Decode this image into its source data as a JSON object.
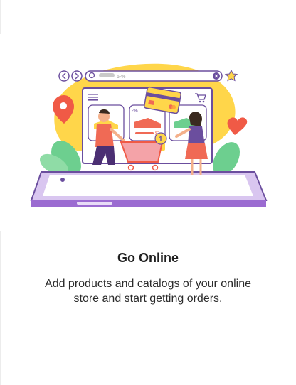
{
  "card": {
    "title": "Go Online",
    "description": "Add products and catalogs of your online store and start getting orders."
  },
  "illustration": {
    "search_text": "5-%",
    "discount_label": "-%",
    "price_label": "$",
    "cart_badge": "1",
    "icons": [
      "chevron-left-icon",
      "chevron-right-icon",
      "search-icon",
      "close-icon",
      "star-icon",
      "menu-icon",
      "cart-icon",
      "location-pin-icon",
      "heart-icon",
      "credit-card-icon",
      "shopping-cart-icon"
    ],
    "colors": {
      "accent": "#9b6bd1",
      "blob": "#ffd64a",
      "leaf": "#6dcf8f",
      "shoe": "#f06a55",
      "pin": "#f05a46"
    }
  }
}
